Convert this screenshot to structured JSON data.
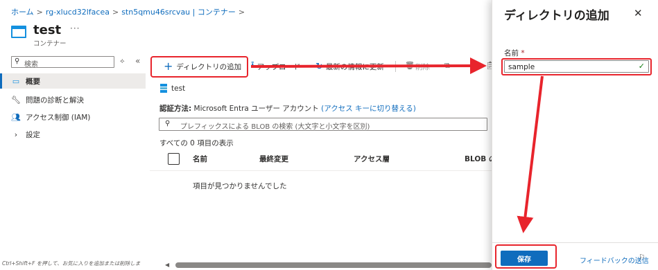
{
  "breadcrumb": {
    "items": [
      "ホーム",
      "rg-xlucd32lfacea",
      "stn5qmu46srcvau | コンテナー"
    ],
    "separator": ">"
  },
  "header": {
    "title": "test",
    "more": "···",
    "subtitle": "コンテナー"
  },
  "sidebar": {
    "search_placeholder": "検索",
    "items": [
      {
        "label": "概要",
        "icon": "container-icon"
      },
      {
        "label": "問題の診断と解決",
        "icon": "wrench-icon"
      },
      {
        "label": "アクセス制御 (IAM)",
        "icon": "people-icon"
      },
      {
        "label": "設定",
        "icon": "chevron-right-icon"
      }
    ],
    "shortcut_hint": "Ctrl+Shift+F を押して、お気に入りを追加または削除しま"
  },
  "toolbar": {
    "add_directory": "ディレクトリの追加",
    "upload": "アップロード",
    "refresh": "最新の情報に更新",
    "delete": "削除"
  },
  "content": {
    "folder_name": "test",
    "auth_label": "認証方法:",
    "auth_value": "Microsoft Entra ユーザー アカウント",
    "auth_switch": "(アクセス キーに切り替える)",
    "blob_search_placeholder": "プレフィックスによる BLOB の検索 (大文字と小文字を区別)",
    "item_count": "すべての 0 項目の表示",
    "columns": [
      "名前",
      "最終変更",
      "アクセス層",
      "BLOB の種"
    ],
    "empty_message": "項目が見つかりませんでした"
  },
  "panel": {
    "title": "ディレクトリの追加",
    "name_label": "名前",
    "required_mark": "*",
    "name_value": "sample",
    "save_label": "保存",
    "feedback_label": "フィードバックの送信"
  },
  "colors": {
    "accent": "#0f6cbd",
    "annotation": "#e8242c",
    "valid": "#107c10"
  }
}
